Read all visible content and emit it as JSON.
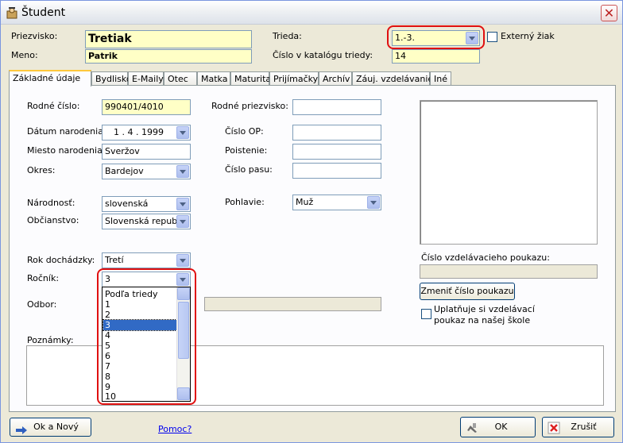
{
  "window": {
    "title": "Študent",
    "close_label": "✕"
  },
  "header": {
    "priezvisko_label": "Priezvisko:",
    "priezvisko_value": "Tretiak",
    "meno_label": "Meno:",
    "meno_value": "Patrik",
    "trieda_label": "Trieda:",
    "trieda_value": "1.-3.",
    "externy_label": "Externý žiak",
    "katalog_label": "Číslo v katalógu triedy:",
    "katalog_value": "14"
  },
  "tabs": [
    {
      "label": "Základné údaje"
    },
    {
      "label": "Bydlisko"
    },
    {
      "label": "E-Maily"
    },
    {
      "label": "Otec"
    },
    {
      "label": "Matka"
    },
    {
      "label": "Maturita"
    },
    {
      "label": "Prijímačky"
    },
    {
      "label": "Archív"
    },
    {
      "label": "Záuj. vzdelávanie"
    },
    {
      "label": "Iné"
    }
  ],
  "form": {
    "rodne_cislo_label": "Rodné číslo:",
    "rodne_cislo_value": "990401/4010",
    "datum_label": "Dátum narodenia:",
    "datum_value": "1 .   4 . 1999",
    "miesto_label": "Miesto narodenia:",
    "miesto_value": "Sveržov",
    "okres_label": "Okres:",
    "okres_value": "Bardejov",
    "narodnost_label": "Národnosť:",
    "narodnost_value": "slovenská",
    "obcianstvo_label": "Občianstvo:",
    "obcianstvo_value": "Slovenská republ",
    "rodne_priezvisko_label": "Rodné priezvisko:",
    "cislo_op_label": "Číslo OP:",
    "poistenie_label": "Poistenie:",
    "cislo_pasu_label": "Číslo pasu:",
    "pohlavie_label": "Pohlavie:",
    "pohlavie_value": "Muž",
    "rok_dochadzky_label": "Rok dochádzky:",
    "rok_dochadzky_value": "Tretí",
    "rocnik_label": "Ročník:",
    "rocnik_value": "3",
    "odbor_label": "Odbor:",
    "poznamky_label": "Poznámky:",
    "poukaz_label": "Číslo vzdelávacieho poukazu:",
    "zmenit_poukaz_label": "Zmeniť číslo poukazu",
    "uplatnuje_line1": "Uplatňuje si vzdelávací",
    "uplatnuje_line2": "poukaz na našej škole"
  },
  "rocnik_options": [
    "Podľa triedy",
    "1",
    "2",
    "3",
    "4",
    "5",
    "6",
    "7",
    "8",
    "9",
    "10"
  ],
  "rocnik_selected": "3",
  "footer": {
    "ok_novy_label": "Ok a Nový",
    "pomoc_label": "Pomoc?",
    "ok_label": "OK",
    "zrusit_label": "Zrušiť"
  },
  "colors": {
    "required_field_bg": "#ffffc6",
    "highlight_ring": "#e01010",
    "active_tab_accent": "#ffc83c",
    "selection": "#316ac5"
  }
}
